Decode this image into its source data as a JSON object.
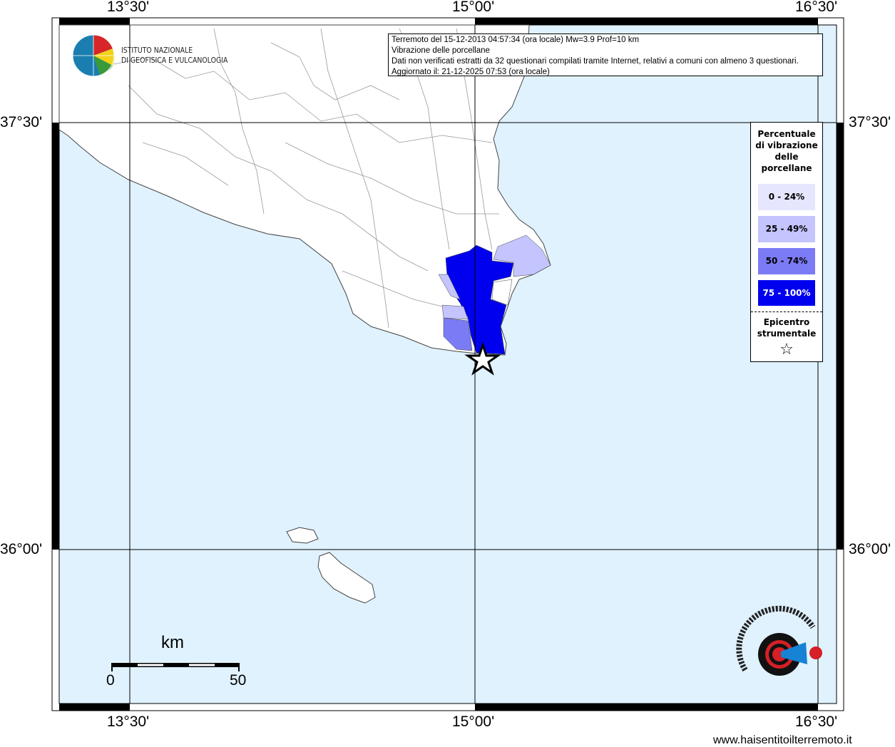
{
  "axes": {
    "top": [
      "13°30'",
      "15°00'",
      "16°30'"
    ],
    "bottom": [
      "13°30'",
      "15°00'",
      "16°30'"
    ],
    "left": [
      "37°30'",
      "36°00'"
    ],
    "right": [
      "37°30'",
      "36°00'"
    ]
  },
  "logo": {
    "line1": "ISTITUTO NAZIONALE",
    "line2": "DI GEOFISICA E VULCANOLOGIA"
  },
  "info": {
    "line1": "Terremoto del 15-12-2013 04:57:34 (ora locale) Mw=3.9 Prof=10 km",
    "line2": "Vibrazione delle porcellane",
    "line3": "Dati non verificati estratti da 32 questionari compilati tramite Internet, relativi a comuni con almeno 3 questionari.",
    "line4": "Aggiornato il: 21-12-2025 07:53 (ora locale)"
  },
  "legend": {
    "title": "Percentuale di vibrazione delle porcellane",
    "classes": [
      {
        "label": "0 - 24%",
        "color": "#e6e6ff"
      },
      {
        "label": "25 - 49%",
        "color": "#c4c4ff"
      },
      {
        "label": "50 - 74%",
        "color": "#7b7bf5"
      },
      {
        "label": "75 - 100%",
        "color": "#0000ee"
      }
    ],
    "epicenter_label": "Epicentro strumentale",
    "epicenter_icon": "star-icon"
  },
  "scale": {
    "unit": "km",
    "min": "0",
    "max": "50"
  },
  "watermark": {
    "text": "www.haisentitoilterremoto.it"
  },
  "colors": {
    "sea": "#e0f2fe",
    "land": "#ffffff"
  }
}
